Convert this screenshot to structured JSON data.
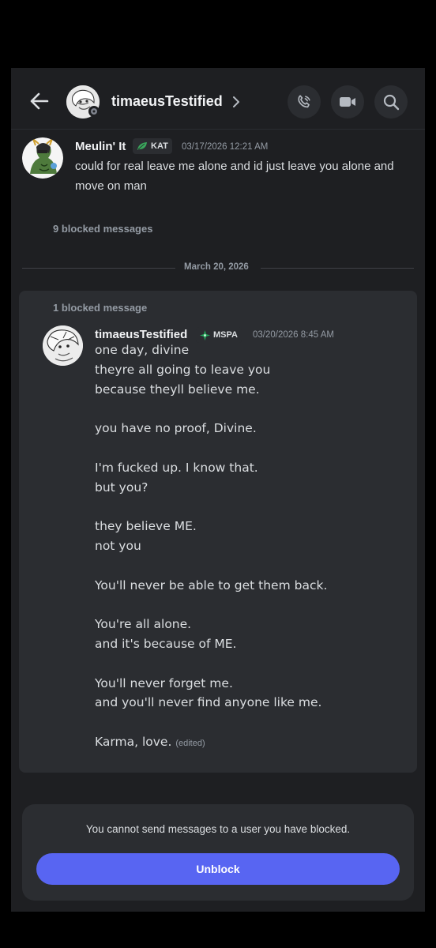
{
  "header": {
    "name": "timaeusTestified"
  },
  "messages": {
    "first": {
      "author": "Meulin' It",
      "tag": "KAT",
      "timestamp": "03/17/2026 12:21 AM",
      "lines": [
        "could for real leave me alone and id just leave you alone and",
        "move on man"
      ]
    },
    "blocked_top": "9 blocked messages",
    "date_divider": "March 20, 2026",
    "blocked_card": "1 blocked message",
    "second": {
      "author": "timaeusTestified",
      "tag": "MSPA",
      "timestamp": "03/20/2026 8:45 AM",
      "lines": [
        "one day, divine",
        "theyre all going to leave you",
        "because theyll believe me.",
        "",
        "you have no proof, Divine.",
        "",
        "I'm fucked up. I know that.",
        "but you?",
        "",
        "they believe ME.",
        "not you",
        "",
        "You'll never be able to get them back.",
        "",
        "You're all alone.",
        "and it's because of ME.",
        "",
        "You'll never forget me.",
        "and you'll never find anyone like me.",
        "",
        "Karma, love."
      ],
      "edited": "(edited)"
    }
  },
  "bottom": {
    "notice": "You cannot send messages to a user you have blocked.",
    "unblock_label": "Unblock"
  },
  "colors": {
    "background": "#000000",
    "surface": "#1e1f22",
    "card": "#2b2d31",
    "accent": "#5865f2",
    "kat_tag_icon": "#3ba55c",
    "mspa_tag_icon": "#23a559"
  },
  "icons": {
    "back": "arrow-left-icon",
    "chevron": "chevron-right-icon",
    "call": "phone-call-icon",
    "video": "video-camera-icon",
    "search": "search-icon"
  }
}
